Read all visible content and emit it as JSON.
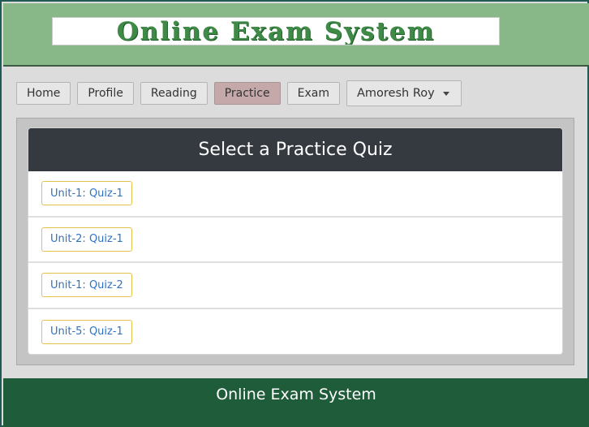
{
  "header": {
    "logo_text": "Online Exam System"
  },
  "nav": {
    "items": [
      {
        "label": "Home"
      },
      {
        "label": "Profile"
      },
      {
        "label": "Reading"
      },
      {
        "label": "Practice"
      },
      {
        "label": "Exam"
      }
    ],
    "active": "Practice",
    "user_label": "Amoresh Roy"
  },
  "card": {
    "title": "Select a Practice Quiz",
    "quizzes": [
      {
        "label": "Unit-1: Quiz-1"
      },
      {
        "label": "Unit-2: Quiz-1"
      },
      {
        "label": "Unit-1: Quiz-2"
      },
      {
        "label": "Unit-5: Quiz-1"
      }
    ]
  },
  "footer": {
    "text": "Online Exam System"
  },
  "colors": {
    "header_bg": "#88b888",
    "active_nav": "#c4a8aa",
    "card_header_bg": "#343a40",
    "quiz_border": "#e5c24a",
    "quiz_text": "#2f73c0",
    "footer_bg": "#1e5c3a"
  }
}
